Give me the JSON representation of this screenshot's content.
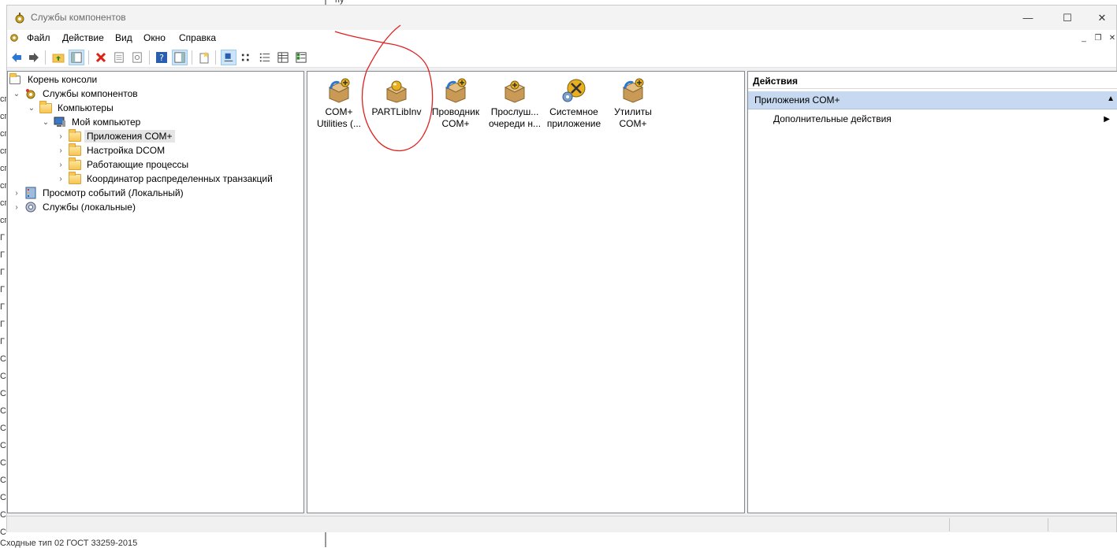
{
  "background": {
    "top_fragment": "пу",
    "bottom_fragment": "Сходные тип 02 ГОСТ 33259-2015",
    "left_fragments": [
      "сп",
      "сп",
      "сп",
      "сп",
      "сп",
      "сп",
      "сп",
      "сп",
      "Г",
      "Г",
      "Г",
      "Г",
      "Г",
      "Г",
      "Г",
      "С",
      "С",
      "С",
      "С",
      "С",
      "С",
      "С",
      "С",
      "С",
      "С",
      "С"
    ]
  },
  "window": {
    "title": "Службы компонентов",
    "controls": {
      "minimize": "—",
      "maximize": "☐",
      "close": "✕"
    }
  },
  "menu": [
    "Файл",
    "Действие",
    "Вид",
    "Окно",
    "Справка"
  ],
  "mdi_controls": {
    "minimize": "_",
    "restore": "❐",
    "close": "✕"
  },
  "tree": [
    {
      "label": "Корень консоли",
      "chevron": ""
    },
    {
      "label": "Службы компонентов",
      "chevron": "⌄"
    },
    {
      "label": "Компьютеры",
      "chevron": "⌄"
    },
    {
      "label": "Мой компьютер",
      "chevron": "⌄"
    },
    {
      "label": "Приложения COM+",
      "chevron": "›"
    },
    {
      "label": "Настройка DCOM",
      "chevron": "›"
    },
    {
      "label": "Работающие процессы",
      "chevron": "›"
    },
    {
      "label": "Координатор распределенных транзакций",
      "chevron": "›"
    },
    {
      "label": "Просмотр событий (Локальный)",
      "chevron": "›"
    },
    {
      "label": "Службы (локальные)",
      "chevron": "›"
    }
  ],
  "com_apps": [
    {
      "line1": "COM+",
      "line2": "Utilities (..."
    },
    {
      "line1": "PARTLibInv",
      "line2": ""
    },
    {
      "line1": "Проводник",
      "line2": "COM+"
    },
    {
      "line1": "Прослуш...",
      "line2": "очереди н..."
    },
    {
      "line1": "Системное",
      "line2": "приложение"
    },
    {
      "line1": "Утилиты",
      "line2": "COM+"
    }
  ],
  "actions": {
    "header": "Действия",
    "section": "Приложения COM+",
    "item": "Дополнительные действия",
    "collapse_glyph": "▲",
    "submenu_glyph": "▶"
  },
  "colors": {
    "selection": "#c6d9f0",
    "annotation": "#e02020"
  }
}
